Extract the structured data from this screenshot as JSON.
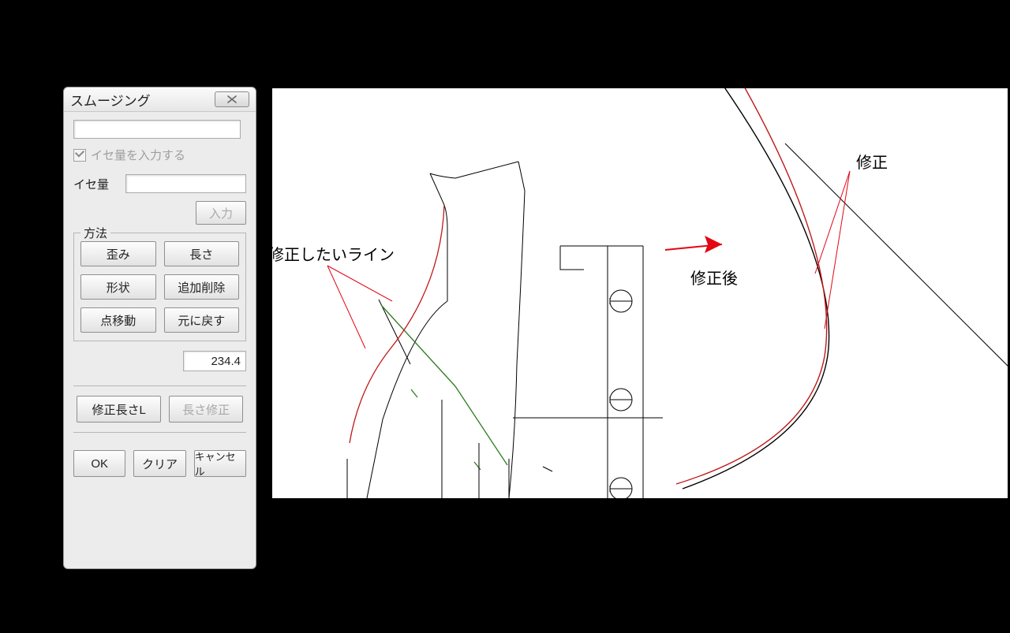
{
  "dialog": {
    "title": "スムージング",
    "cb_label": "イセ量を入力する",
    "ise_label": "イセ量",
    "input_btn": "入力",
    "method_legend": "方法",
    "buttons": {
      "distort": "歪み",
      "length": "長さ",
      "shape": "形状",
      "add_remove": "追加削除",
      "move_point": "点移動",
      "undo": "元に戻す"
    },
    "value": "234.4",
    "fix_len_L": "修正長さL",
    "fix_len": "長さ修正",
    "ok": "OK",
    "clear": "クリア",
    "cancel": "キャンセル"
  },
  "canvas": {
    "label_line_to_fix": "修正したいライン",
    "label_after": "修正後",
    "label_after2": "修正"
  },
  "colors": {
    "red": "#E30613",
    "darkred": "#C01818",
    "green": "#2F7A1F",
    "black": "#000000"
  }
}
